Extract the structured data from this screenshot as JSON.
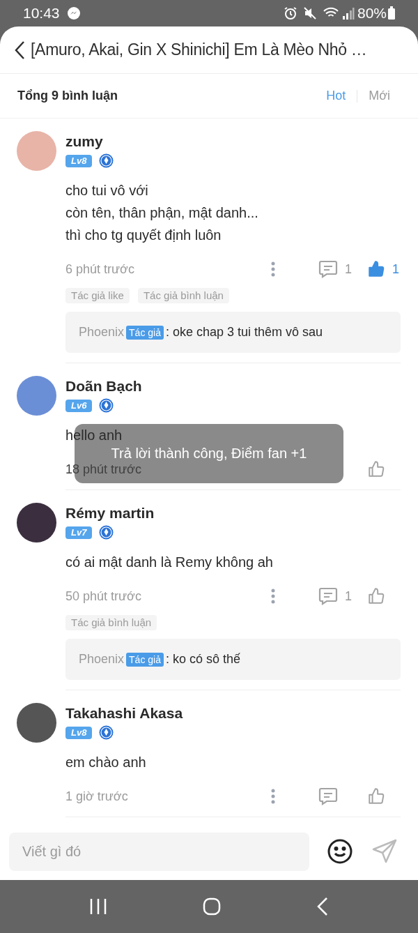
{
  "status_bar": {
    "time": "10:43",
    "battery": "80%"
  },
  "header": {
    "title": "[Amuro, Akai, Gin X Shinichi] Em Là Mèo Nhỏ …"
  },
  "summary": {
    "total": "Tổng 9 bình luận",
    "sorts": [
      {
        "label": "Hot",
        "selected": true
      },
      {
        "label": "Mới",
        "selected": false
      }
    ]
  },
  "comments": [
    {
      "name": "zumy",
      "level": "Lv8",
      "lines": [
        "cho tui vô với",
        "còn tên, thân phận, mật danh...",
        "thì cho tg quyết định luôn"
      ],
      "time": "6 phút trước",
      "reply_count": "1",
      "liked": true,
      "like_count": "1",
      "tags": [
        "Tác giả like",
        "Tác giả bình luận"
      ],
      "reply": {
        "author": "Phoenix",
        "badge": "Tác giả",
        "text": ": oke chap 3 tui thêm vô sau"
      }
    },
    {
      "name": "Doãn Bạch",
      "level": "Lv6",
      "lines": [
        "hello anh"
      ],
      "time": "18 phút trước",
      "liked": false,
      "toast": "Trả lời thành công, Điểm fan +1"
    },
    {
      "name": "Rémy martin",
      "level": "Lv7",
      "lines": [
        "có ai mật danh là Remy không ah"
      ],
      "time": "50 phút trước",
      "reply_count": "1",
      "liked": false,
      "tags": [
        "Tác giả bình luận"
      ],
      "reply": {
        "author": "Phoenix",
        "badge": "Tác giả",
        "text": ": ko có sô thế"
      }
    },
    {
      "name": "Takahashi Akasa",
      "level": "Lv8",
      "lines": [
        "em chào anh"
      ],
      "time": "1 giờ trước",
      "liked": false
    }
  ],
  "composer": {
    "placeholder": "Viết gì đó"
  }
}
